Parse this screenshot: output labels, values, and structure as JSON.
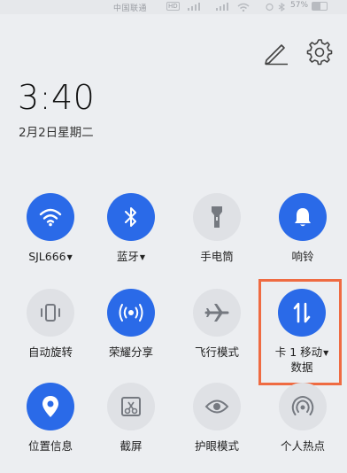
{
  "status_bar": {
    "carrier": "中国联通",
    "network_badge": "HD",
    "battery_text": "57%",
    "icons": [
      "signal-icon",
      "signal-icon",
      "wifi-icon",
      "alarm-icon",
      "bluetooth-icon",
      "battery-icon"
    ]
  },
  "header": {
    "edit_icon": "pencil-icon",
    "settings_icon": "gear-icon"
  },
  "clock": {
    "time": "3:40",
    "date": "2月2日星期二"
  },
  "tiles": [
    {
      "label": "SJL666",
      "has_caret": true,
      "active": true,
      "icon": "wifi-icon"
    },
    {
      "label": "蓝牙",
      "has_caret": true,
      "active": true,
      "icon": "bluetooth-icon"
    },
    {
      "label": "手电筒",
      "has_caret": false,
      "active": false,
      "icon": "flashlight-icon"
    },
    {
      "label": "响铃",
      "has_caret": false,
      "active": true,
      "icon": "bell-icon"
    },
    {
      "label": "自动旋转",
      "has_caret": false,
      "active": false,
      "icon": "auto-rotate-icon"
    },
    {
      "label": "荣耀分享",
      "has_caret": false,
      "active": true,
      "icon": "share-icon"
    },
    {
      "label": "飞行模式",
      "has_caret": false,
      "active": false,
      "icon": "airplane-icon"
    },
    {
      "label": "卡 1 移动",
      "label_line2": "数据",
      "has_caret": true,
      "active": true,
      "icon": "mobile-data-icon",
      "highlighted": true
    },
    {
      "label": "位置信息",
      "has_caret": false,
      "active": true,
      "icon": "location-icon"
    },
    {
      "label": "截屏",
      "has_caret": false,
      "active": false,
      "icon": "screenshot-icon"
    },
    {
      "label": "护眼模式",
      "has_caret": false,
      "active": false,
      "icon": "eye-icon"
    },
    {
      "label": "个人热点",
      "has_caret": false,
      "active": false,
      "icon": "hotspot-icon"
    }
  ],
  "colors": {
    "accent": "#2a6ae8",
    "tile_off": "#dfe1e5",
    "background": "#eceef1",
    "highlight": "#ef6b42"
  }
}
